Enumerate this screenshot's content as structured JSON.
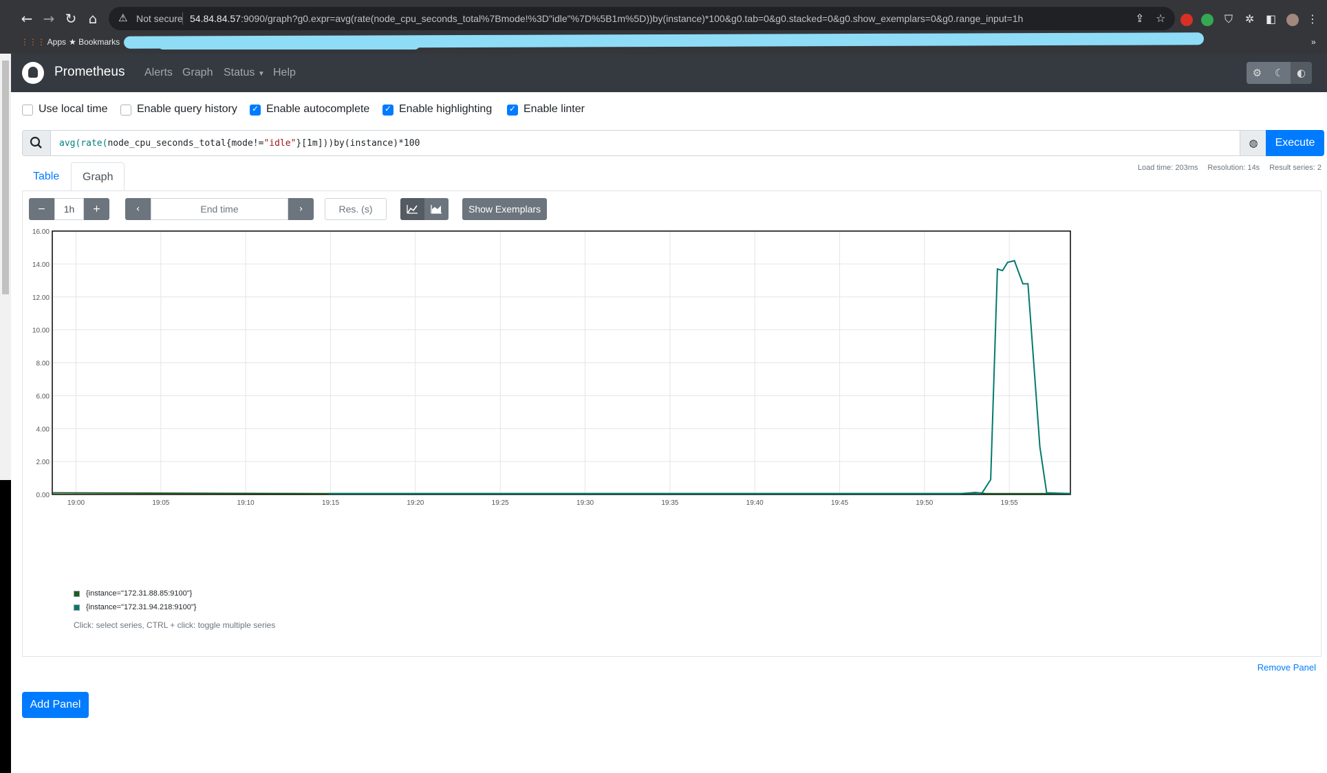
{
  "browser": {
    "not_secure": "Not secure",
    "url_host": "54.84.84.57",
    "url_rest": ":9090/graph?g0.expr=avg(rate(node_cpu_seconds_total%7Bmode!%3D\"idle\"%7D%5B1m%5D))by(instance)*100&g0.tab=0&g0.stacked=0&g0.show_exemplars=0&g0.range_input=1h",
    "bookmarks": {
      "apps": "Apps",
      "bookmarks": "Bookmarks"
    }
  },
  "navbar": {
    "brand": "Prometheus",
    "links": [
      "Alerts",
      "Graph",
      "Status",
      "Help"
    ]
  },
  "settings": {
    "use_local_time": {
      "label": "Use local time",
      "checked": false
    },
    "query_history": {
      "label": "Enable query history",
      "checked": false
    },
    "autocomplete": {
      "label": "Enable autocomplete",
      "checked": true
    },
    "highlighting": {
      "label": "Enable highlighting",
      "checked": true
    },
    "linter": {
      "label": "Enable linter",
      "checked": true
    }
  },
  "query": {
    "fn1": "avg(rate(",
    "metric": "node_cpu_seconds_total{",
    "label": "mode",
    "op": "!=",
    "value": "\"idle\"",
    "rest": "}[1m]))by(instance)*100",
    "execute": "Execute"
  },
  "tabs": {
    "table": "Table",
    "graph": "Graph"
  },
  "stats": {
    "load_time": "Load time: 203ms",
    "resolution": "Resolution: 14s",
    "result_series": "Result series: 2"
  },
  "controls": {
    "minus": "−",
    "range": "1h",
    "plus": "+",
    "prev": "‹",
    "end_time_placeholder": "End time",
    "next": "›",
    "res_placeholder": "Res. (s)",
    "show_exemplars": "Show Exemplars"
  },
  "colors": {
    "series1": "#1b5e20",
    "series2": "#00796b",
    "accent": "#007bff",
    "navbar": "#343a40"
  },
  "chart_data": {
    "type": "line",
    "title": "",
    "xlabel": "",
    "ylabel": "",
    "ylim": [
      0,
      16
    ],
    "yticks": [
      "0.00",
      "2.00",
      "4.00",
      "6.00",
      "8.00",
      "10.00",
      "12.00",
      "14.00",
      "16.00"
    ],
    "xlim": [
      "18:58.6",
      "19:58.6"
    ],
    "xticks": [
      "19:00",
      "19:05",
      "19:10",
      "19:15",
      "19:20",
      "19:25",
      "19:30",
      "19:35",
      "19:40",
      "19:45",
      "19:50",
      "19:55"
    ],
    "grid": true,
    "series": [
      {
        "name": "{instance=\"172.31.88.85:9100\"}",
        "color": "#1b5e20",
        "x_minutes": [
          -1.4,
          -0.9,
          14.9,
          15.0,
          52.1,
          53.0,
          53.6,
          54.0,
          55.0,
          56.0,
          57.0,
          58.6
        ],
        "values": [
          0.1,
          0.1,
          0.05,
          0.05,
          0.05,
          0.12,
          0.05,
          0.05,
          0.05,
          0.05,
          0.05,
          0.05
        ]
      },
      {
        "name": "{instance=\"172.31.94.218:9100\"}",
        "color": "#00796b",
        "x_minutes": [
          14.9,
          52.0,
          53.4,
          53.9,
          54.3,
          54.6,
          54.9,
          55.3,
          55.8,
          56.1,
          56.8,
          57.2,
          58.6
        ],
        "values": [
          0.05,
          0.05,
          0.1,
          0.9,
          13.7,
          13.6,
          14.1,
          14.2,
          12.8,
          12.8,
          2.9,
          0.1,
          0.05
        ]
      }
    ],
    "legend": [
      "{instance=\"172.31.88.85:9100\"}",
      "{instance=\"172.31.94.218:9100\"}"
    ],
    "legend_position": "bottom-left"
  },
  "legend_hint": "Click: select series, CTRL + click: toggle multiple series",
  "remove_panel": "Remove Panel",
  "add_panel": "Add Panel"
}
